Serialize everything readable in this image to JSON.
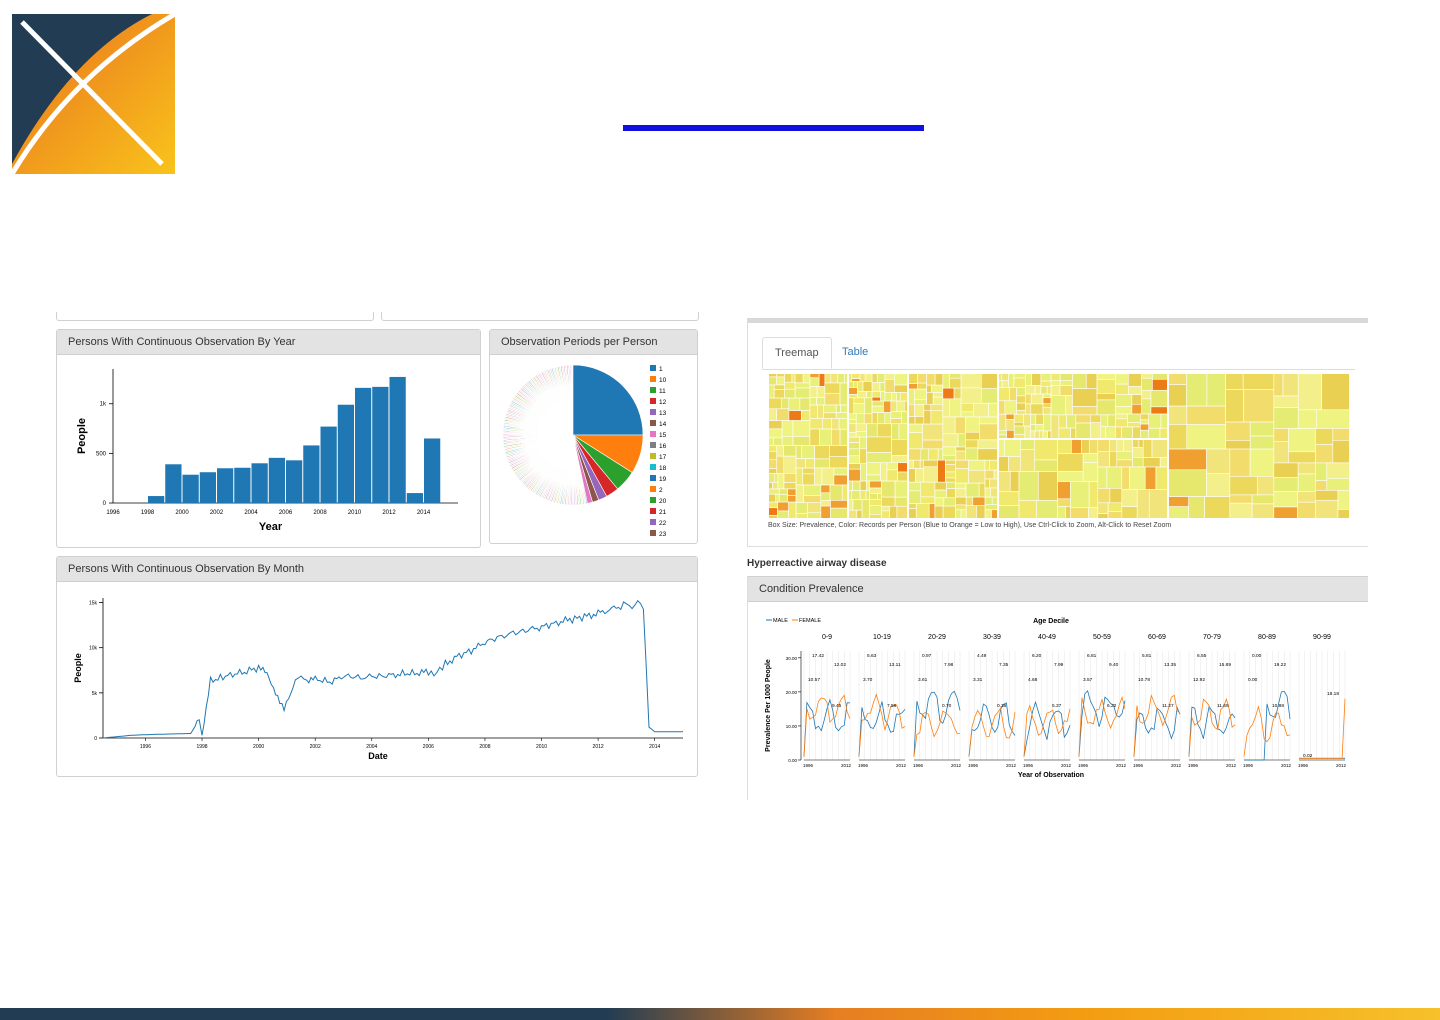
{
  "colors": {
    "brand_dark": "#213c53",
    "brand_orange": "#f0882b",
    "brand_yellow": "#f7bd1b",
    "bar_blue": "#1f77b4",
    "line_orange": "#ff7f0e",
    "title_rule": "#1010e0"
  },
  "logo": {
    "icon": "x-logo-icon"
  },
  "left_dashboard": {
    "year_panel": {
      "title": "Persons With Continuous Observation By Year"
    },
    "periods_panel": {
      "title": "Observation Periods per Person"
    },
    "month_panel": {
      "title": "Persons With Continuous Observation By Month"
    }
  },
  "right_dashboard": {
    "tabs": [
      {
        "label": "Treemap"
      },
      {
        "label": "Table"
      }
    ],
    "treemap_caption": "Box Size: Prevalence, Color: Records per Person (Blue to Orange = Low to High), Use Ctrl-Click to Zoom, Alt-Click to Reset Zoom",
    "condition_name": "Hyperreactive airway disease",
    "prevalence_panel": {
      "title": "Condition Prevalence"
    }
  },
  "chart_data": [
    {
      "type": "bar",
      "title": "Persons With Continuous Observation By Year",
      "xlabel": "Year",
      "ylabel": "People",
      "categories": [
        "1996",
        "1997",
        "1998",
        "1999",
        "2000",
        "2001",
        "2002",
        "2003",
        "2004",
        "2005",
        "2006",
        "2007",
        "2008",
        "2009",
        "2010",
        "2011",
        "2012",
        "2013",
        "2014",
        "2015"
      ],
      "values": [
        0,
        0,
        70,
        390,
        285,
        310,
        350,
        355,
        400,
        455,
        430,
        580,
        770,
        990,
        1160,
        1170,
        1270,
        100,
        650,
        0
      ],
      "ylim": [
        0,
        1350
      ],
      "y_ticks": [
        "0",
        "500",
        "1k"
      ],
      "x_ticks": [
        "1996",
        "1998",
        "2000",
        "2002",
        "2004",
        "2006",
        "2008",
        "2010",
        "2012",
        "2014"
      ]
    },
    {
      "type": "pie",
      "title": "Observation Periods per Person",
      "legend": [
        "1",
        "10",
        "11",
        "12",
        "13",
        "14",
        "15",
        "16",
        "17",
        "18",
        "19",
        "2",
        "20",
        "21",
        "22",
        "23"
      ],
      "legend_colors": [
        "#1f77b4",
        "#ff7f0e",
        "#2ca02c",
        "#d62728",
        "#9467bd",
        "#8c564b",
        "#e377c2",
        "#7f7f7f",
        "#bcbd22",
        "#17becf",
        "#1f77b4",
        "#ff7f0e",
        "#2ca02c",
        "#d62728",
        "#9467bd",
        "#8c564b"
      ],
      "values": [
        25,
        9,
        5,
        3,
        2,
        1.5,
        1.2
      ]
    },
    {
      "type": "line",
      "title": "Persons With Continuous Observation By Month",
      "xlabel": "Date",
      "ylabel": "People",
      "y_ticks": [
        "0",
        "5k",
        "10k",
        "15k"
      ],
      "x_ticks": [
        "1996",
        "1998",
        "2000",
        "2002",
        "2004",
        "2006",
        "2008",
        "2010",
        "2012",
        "2014"
      ],
      "ylim": [
        0,
        15500
      ],
      "xlim": [
        1994.5,
        2015
      ],
      "x": [
        1994.5,
        1995.5,
        1996.3,
        1997,
        1997.6,
        1997.9,
        1998,
        1998.3,
        1999,
        1999.5,
        2000,
        2000.3,
        2000.6,
        2000.9,
        2001.3,
        2001.5,
        2001.7,
        2002,
        2002.6,
        2003,
        2003.6,
        2004,
        2004.6,
        2005,
        2005.6,
        2006,
        2006.2,
        2006.4,
        2006.6,
        2007,
        2007.6,
        2008,
        2008.6,
        2009,
        2009.6,
        2010,
        2010.6,
        2011,
        2011.6,
        2012,
        2012.4,
        2012.8,
        2013,
        2013.2,
        2013.4,
        2013.6,
        2013.8,
        2014,
        2015
      ],
      "y": [
        0,
        300,
        400,
        450,
        500,
        2000,
        300,
        6300,
        7000,
        7300,
        7800,
        7000,
        5200,
        3000,
        6500,
        6800,
        6400,
        6500,
        6200,
        6900,
        6700,
        6800,
        6900,
        7100,
        7200,
        7300,
        7000,
        7600,
        8200,
        9000,
        9800,
        10600,
        11300,
        11600,
        12000,
        12300,
        12800,
        13100,
        13500,
        13800,
        14200,
        14600,
        15000,
        14300,
        15200,
        14400,
        1200,
        700,
        700
      ]
    },
    {
      "type": "line",
      "title": "Condition Prevalence",
      "xlabel": "Year of Observation",
      "ylabel": "Prevalence Per 1000 People",
      "group_title": "Age Decile",
      "legend": [
        "MALE",
        "FEMALE"
      ],
      "deciles": [
        "0-9",
        "10-19",
        "20-29",
        "30-39",
        "40-49",
        "50-59",
        "60-69",
        "70-79",
        "80-89",
        "90-99"
      ],
      "y_ticks": [
        "0.00",
        "10.00",
        "20.00",
        "30.00"
      ],
      "x_ticks": [
        "1996",
        "2012"
      ],
      "ylim": [
        0,
        32
      ],
      "annotations": [
        [
          "17.42",
          "12.02",
          "10.57",
          "9.45"
        ],
        [
          "5.63",
          "13.11",
          "3.70",
          "7.59"
        ],
        [
          "0.97",
          "7.98",
          "3.61",
          "0.70"
        ],
        [
          "4.49",
          "7.35",
          "3.31",
          "0.35"
        ],
        [
          "6.20",
          "7.99",
          "4.68",
          "5.37"
        ],
        [
          "6.81",
          "9.40",
          "3.57",
          "6.22"
        ],
        [
          "5.81",
          "13.35",
          "10.78",
          "11.27"
        ],
        [
          "6.55",
          "15.89",
          "12.92",
          "11.69"
        ],
        [
          "0.00",
          "19.22",
          "0.00",
          "10.88"
        ],
        [
          "18.18",
          "0.02"
        ]
      ]
    }
  ]
}
